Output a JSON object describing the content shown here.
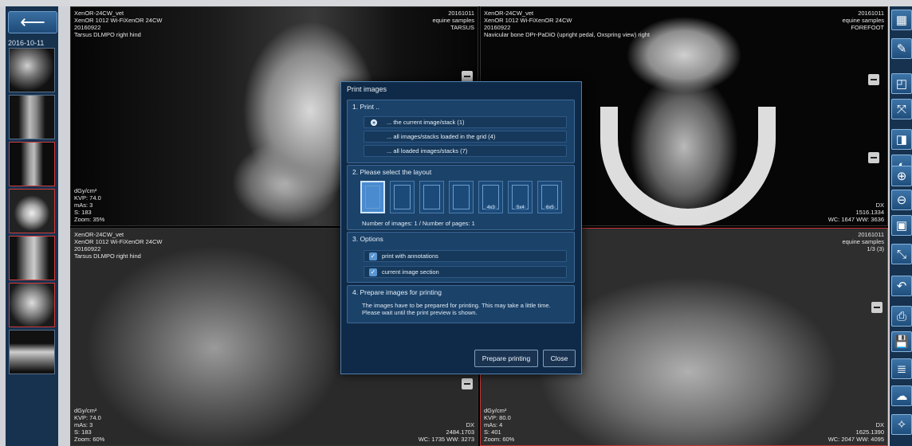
{
  "sidebar": {
    "date": "2016-10-11",
    "thumbs": [
      "thumb1",
      "thumb2",
      "thumb3",
      "thumb4",
      "thumb5",
      "thumb6",
      "thumb7"
    ]
  },
  "viewports": [
    {
      "tl": "XenOR-24CW_vet\nXenOR 1012 Wi-FiXenOR 24CW\n20160922\nTarsus DLMPO right hind",
      "tr": "20161011\nequine samples\nTARSUS",
      "bl": "dGy/cm²\nKVP: 74.0\nmAs: 3\nS: 183\nZoom: 35%",
      "br": ""
    },
    {
      "tl": "XenOR-24CW_vet\nXenOR 1012 Wi-FiXenOR 24CW\n20160922\nNavicular bone DPr-PaDiO (upright pedal, Oxspring view) right",
      "tr": "20161011\nequine samples\nFOREFOOT",
      "bl": "",
      "br": "DX\n1516.1334\nWC: 1647 WW: 3636"
    },
    {
      "tl": "XenOR-24CW_vet\nXenOR 1012 Wi-FiXenOR 24CW\n20160922\nTarsus DLMPO right hind",
      "tr": "",
      "bl": "dGy/cm²\nKVP: 74.0\nmAs: 3\nS: 183\nZoom: 60%",
      "br": "DX\n2484.1703\nWC: 1735 WW: 3273"
    },
    {
      "tl": "",
      "tr": "20161011\nequine samples\n1/3 (3)",
      "bl": "dGy/cm²\nKVP: 80.0\nmAs: 4\nS: 401\nZoom: 60%",
      "br": "DX\n1625.1390\nWC: 2047 WW: 4095"
    }
  ],
  "toolbar": {
    "icons": [
      "grid-layout-icon",
      "pen-annotate-icon",
      "measure-icon",
      "flip-icon",
      "invert-icon",
      "contrast-icon",
      "zoom-in-icon",
      "zoom-out-icon",
      "fit-screen-icon",
      "shrink-icon",
      "undo-icon",
      "print-icon",
      "save-icon",
      "layers-icon",
      "cloud-upload-icon",
      "magic-icon"
    ],
    "glyphs": [
      "▦",
      "✎",
      "◰",
      "⤧",
      "◨",
      "◐",
      "⊕",
      "⊖",
      "▣",
      "⤡",
      "↶",
      "⎙",
      "💾",
      "≣",
      "☁",
      "✧"
    ]
  },
  "dialog": {
    "title": "Print images",
    "section1": {
      "title": "1. Print ..",
      "options": [
        {
          "label": "... the current image/stack (1)",
          "selected": true
        },
        {
          "label": "... all images/stacks loaded in the grid (4)",
          "selected": false
        },
        {
          "label": "... all loaded images/stacks (7)",
          "selected": false
        }
      ]
    },
    "section2": {
      "title": "2. Please select the layout",
      "layouts": [
        "",
        "",
        "",
        "",
        "4x3",
        "5x4",
        "6x5"
      ],
      "selected_index": 0,
      "stats": "Number of images: 1  /  Number of pages: 1"
    },
    "section3": {
      "title": "3. Options",
      "options": [
        {
          "label": "print with annotations",
          "checked": true
        },
        {
          "label": "current image section",
          "checked": true
        }
      ]
    },
    "section4": {
      "title": "4. Prepare images for printing",
      "description": "The images have to be prepared for printing. This may take a little time.\nPlease wait until the print preview is shown."
    },
    "buttons": {
      "prepare": "Prepare printing",
      "close": "Close"
    }
  }
}
